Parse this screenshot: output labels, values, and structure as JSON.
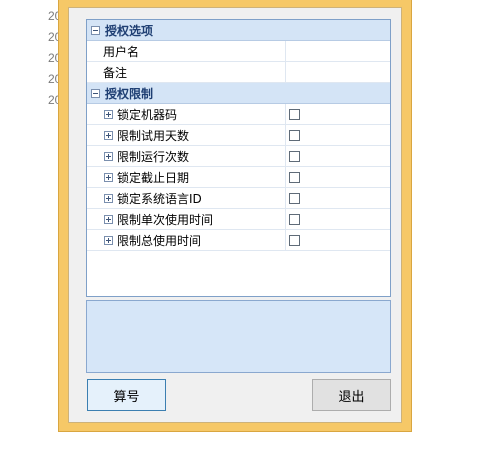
{
  "background": {
    "numbers": [
      "20",
      "20",
      "20",
      "20",
      "20"
    ]
  },
  "property_grid": {
    "categories": [
      {
        "label": "授权选项",
        "rows": [
          {
            "label": "用户名",
            "value": ""
          },
          {
            "label": "备注",
            "value": ""
          }
        ]
      },
      {
        "label": "授权限制",
        "rows": [
          {
            "label": "锁定机器码"
          },
          {
            "label": "限制试用天数"
          },
          {
            "label": "限制运行次数"
          },
          {
            "label": "锁定截止日期"
          },
          {
            "label": "锁定系统语言ID"
          },
          {
            "label": "限制单次使用时间"
          },
          {
            "label": "限制总使用时间"
          }
        ]
      }
    ]
  },
  "buttons": {
    "calculate_label": "算号",
    "exit_label": "退出"
  },
  "colors": {
    "window_frame": "#f6c867",
    "category_band": "#d4e4f6",
    "description_panel": "#d6e6f8",
    "accent_border": "#3c7fb1"
  }
}
